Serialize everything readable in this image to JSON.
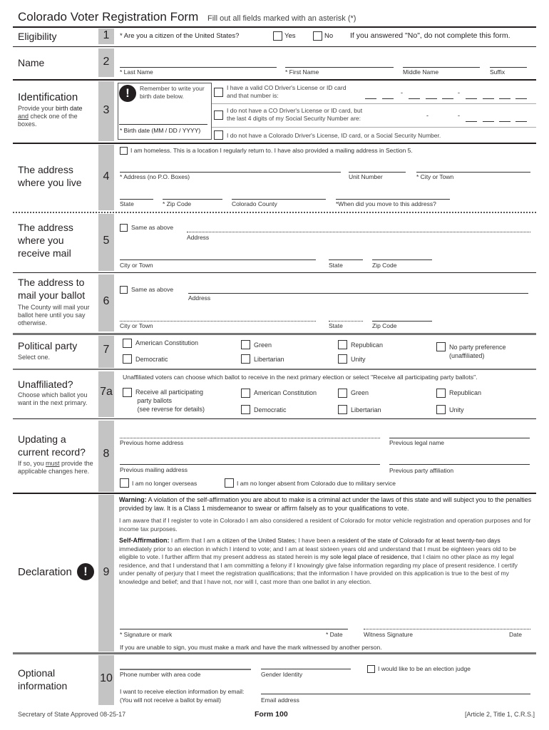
{
  "header": {
    "title": "Colorado Voter Registration Form",
    "subtitle": "Fill out all fields marked with an asterisk (*)"
  },
  "sections": {
    "s1": {
      "number": "1",
      "title": "Eligibility",
      "question": "* Are you a citizen of the United States?",
      "yes_label": "Yes",
      "no_label": "No",
      "note": "If you answered \"No\", do not complete this form."
    },
    "s2": {
      "number": "2",
      "title": "Name",
      "fields": [
        "* Last Name",
        "* First Name",
        "Middle Name",
        "Suffix"
      ]
    },
    "s3": {
      "number": "3",
      "title": "Identification",
      "desc_pre": "Provide your ",
      "desc_bold": "birth date",
      "desc_underline": "and",
      "desc_post": " check one of the boxes.",
      "reminder": "Remember to write your birth date below.",
      "birth_label": "* Birth date (MM / DD / YYYY)",
      "option1_line1": "I have a valid CO Driver's License or ID card",
      "option1_line2": "and that number is:",
      "option2_line1": "I do not have a CO Driver's License or ID card, but",
      "option2_line2": "the last 4 digits of my Social Security Number are:",
      "option3": "I do not have a Colorado Driver's License, ID card, or a Social Security Number.",
      "hyphen": "-"
    },
    "s4": {
      "number": "4",
      "title_line1": "The address",
      "title_line2": "where you live",
      "homeless": "I am homeless. This is a location I regularly return to. I have also provided a mailing address in Section 5.",
      "fields_row1": [
        "* Address (no P.O. Boxes)",
        "Unit Number",
        "* City or Town"
      ],
      "fields_row2": [
        "State",
        "* Zip Code",
        "Colorado County",
        "*When did you move to this address?"
      ]
    },
    "s5": {
      "number": "5",
      "title_line1": "The address",
      "title_line2": "where you",
      "title_line3": "receive mail",
      "same_as_above": "Same as above",
      "address": "Address",
      "city": "City or Town",
      "state": "State",
      "zip": "Zip Code"
    },
    "s6": {
      "number": "6",
      "title_line1": "The address to",
      "title_line2": "mail your ballot",
      "desc": "The County will mail your ballot here until you say otherwise.",
      "same_as_above": "Same as above",
      "address": "Address",
      "city": "City or Town",
      "state": "State",
      "zip": "Zip Code"
    },
    "s7": {
      "number": "7",
      "title": "Political party",
      "desc": "Select one.",
      "options": [
        "American Constitution",
        "Democratic",
        "Green",
        "Libertarian",
        "Republican",
        "Unity"
      ],
      "no_party_line1": "No party preference",
      "no_party_line2": "(unaffiliated)"
    },
    "s7a": {
      "number": "7a",
      "title": "Unaffiliated?",
      "desc": "Choose which ballot you want in the next primary.",
      "intro": "Unaffiliated voters can choose which ballot to receive in the next primary election or select \"Receive all participating party ballots\".",
      "receive_all_line1": "Receive all participating",
      "receive_all_line2": "party ballots",
      "receive_all_line3": "(see reverse for details)",
      "options": [
        "American Constitution",
        "Democratic",
        "Green",
        "Libertarian",
        "Republican",
        "Unity"
      ]
    },
    "s8": {
      "number": "8",
      "title_line1": "Updating a",
      "title_line2": "current record?",
      "desc_pre": "If so, you ",
      "desc_underline": "must",
      "desc_post": " provide the applicable changes here.",
      "fields": [
        "Previous home address",
        "Previous legal name",
        "Previous mailing address",
        "Previous party affiliation"
      ],
      "overseas": "I am no longer overseas",
      "military": "I am no longer absent from Colorado due to military service"
    },
    "s9": {
      "number": "9",
      "title": "Declaration",
      "warning_label": "Warning:",
      "warning_text": " A violation of the self-affirmation you are about to make is a criminal act under the laws of this state and will subject you to the penalties provided by law.  It is a Class 1 misdemeanor to swear or affirm falsely as to your qualifications to vote.",
      "aware_text": "I am aware that if I register to vote in Colorado I am also considered a resident of Colorado for motor vehicle registration and operation purposes and for income tax purposes.",
      "affirm_label": "Self-Affirmation:",
      "affirm_1": "  I affirm that I am ",
      "affirm_b1": "a citizen of the United States",
      "affirm_2": "; I have been ",
      "affirm_b2": "a resident of the state of Colorado for at least twenty-two days",
      "affirm_3": " immediately prior to an election in which I intend to vote; and I am at least sixteen years old and understand that I must be eighteen years old to be eligible to vote. I further affirm that my present address as stated herein is ",
      "affirm_b3": "my sole legal place of residence",
      "affirm_4": ", that I claim no other place as my legal residence, and that I understand that I am committing a felony if I knowingly give false information regarding my place of present residence. I certify under penalty of perjury that I meet the registration qualifications; that the information I have provided on this application is true to the best of my knowledge and belief; and that I have not, nor will I, cast more than one ballot in any election.",
      "signature": "* Signature or mark",
      "date": "* Date",
      "witness": "Witness Signature",
      "witness_date": "Date",
      "unable_note": "If you are unable to sign, you must make a mark and have the mark witnessed by another person."
    },
    "s10": {
      "number": "10",
      "title_line1": "Optional",
      "title_line2": "information",
      "phone": "Phone number with area code",
      "gender": "Gender Identity",
      "judge": "I would like to be an election judge",
      "email_pref_line1": "I want to receive election information by email:",
      "email_pref_line2": "(You will not receive a ballot by email)",
      "email": "Email address"
    }
  },
  "footer": {
    "approved": "Secretary of State Approved 08-25-17",
    "form": "Form 100",
    "article": "[Article 2, Title 1, C.R.S.]"
  }
}
